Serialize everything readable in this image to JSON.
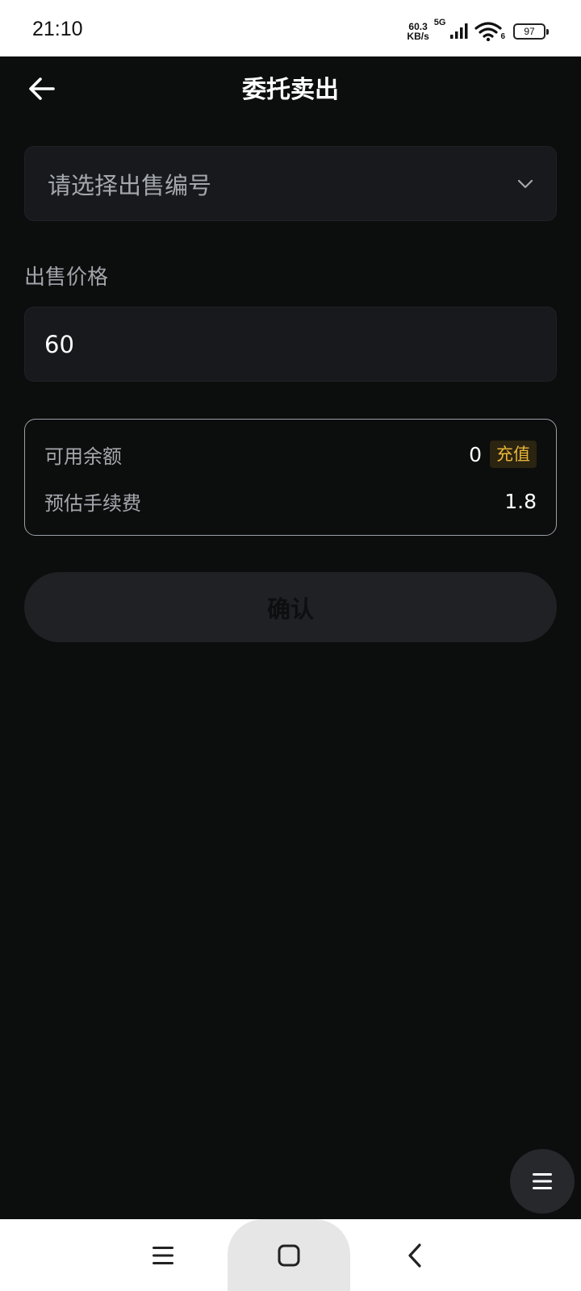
{
  "status_bar": {
    "time": "21:10",
    "net_speed_value": "60.3",
    "net_speed_unit": "KB/s",
    "network_type": "5G",
    "wifi_sub": "6",
    "battery": "97"
  },
  "header": {
    "title": "委托卖出",
    "back_icon": "arrow-left-icon"
  },
  "form": {
    "select_placeholder": "请选择出售编号",
    "price_label": "出售价格",
    "price_value": "60"
  },
  "info": {
    "balance_label": "可用余额",
    "balance_value": "0",
    "recharge_label": "充值",
    "fee_label": "预估手续费",
    "fee_value": "1.8"
  },
  "confirm_label": "确认",
  "colors": {
    "background": "#0c0d0d",
    "field": "#17191c",
    "accent": "#e9b43a",
    "button_disabled": "#1f2125"
  }
}
